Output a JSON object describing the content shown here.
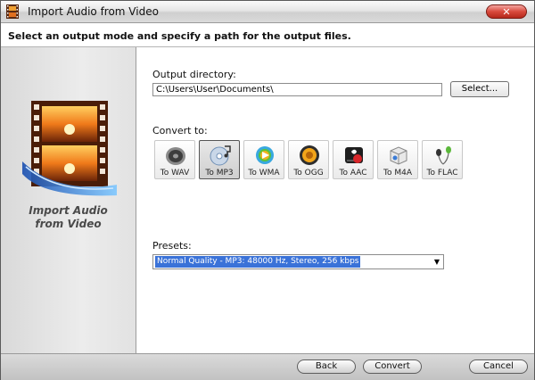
{
  "window": {
    "title": "Import Audio from Video"
  },
  "header": {
    "instruction": "Select an output mode and specify a path for the output files."
  },
  "sidebar": {
    "caption_line1": "Import Audio",
    "caption_line2": "from Video"
  },
  "output": {
    "label": "Output directory:",
    "path": "C:\\Users\\User\\Documents\\",
    "select_label": "Select..."
  },
  "convert": {
    "label": "Convert to:",
    "formats": [
      {
        "label": "To WAV",
        "icon": "speaker-icon",
        "selected": false
      },
      {
        "label": "To MP3",
        "icon": "mp3-disc-icon",
        "selected": true
      },
      {
        "label": "To WMA",
        "icon": "media-player-icon",
        "selected": false
      },
      {
        "label": "To OGG",
        "icon": "ogg-speaker-icon",
        "selected": false
      },
      {
        "label": "To AAC",
        "icon": "aac-icon",
        "selected": false
      },
      {
        "label": "To M4A",
        "icon": "m4a-box-icon",
        "selected": false
      },
      {
        "label": "To FLAC",
        "icon": "flac-earphones-icon",
        "selected": false
      }
    ]
  },
  "presets": {
    "label": "Presets:",
    "value": "Normal Quality - MP3: 48000 Hz, Stereo, 256 kbps"
  },
  "footer": {
    "back_label": "Back",
    "convert_label": "Convert",
    "cancel_label": "Cancel"
  },
  "colors": {
    "selection": "#3a72d8",
    "close_button": "#d94a3c"
  }
}
